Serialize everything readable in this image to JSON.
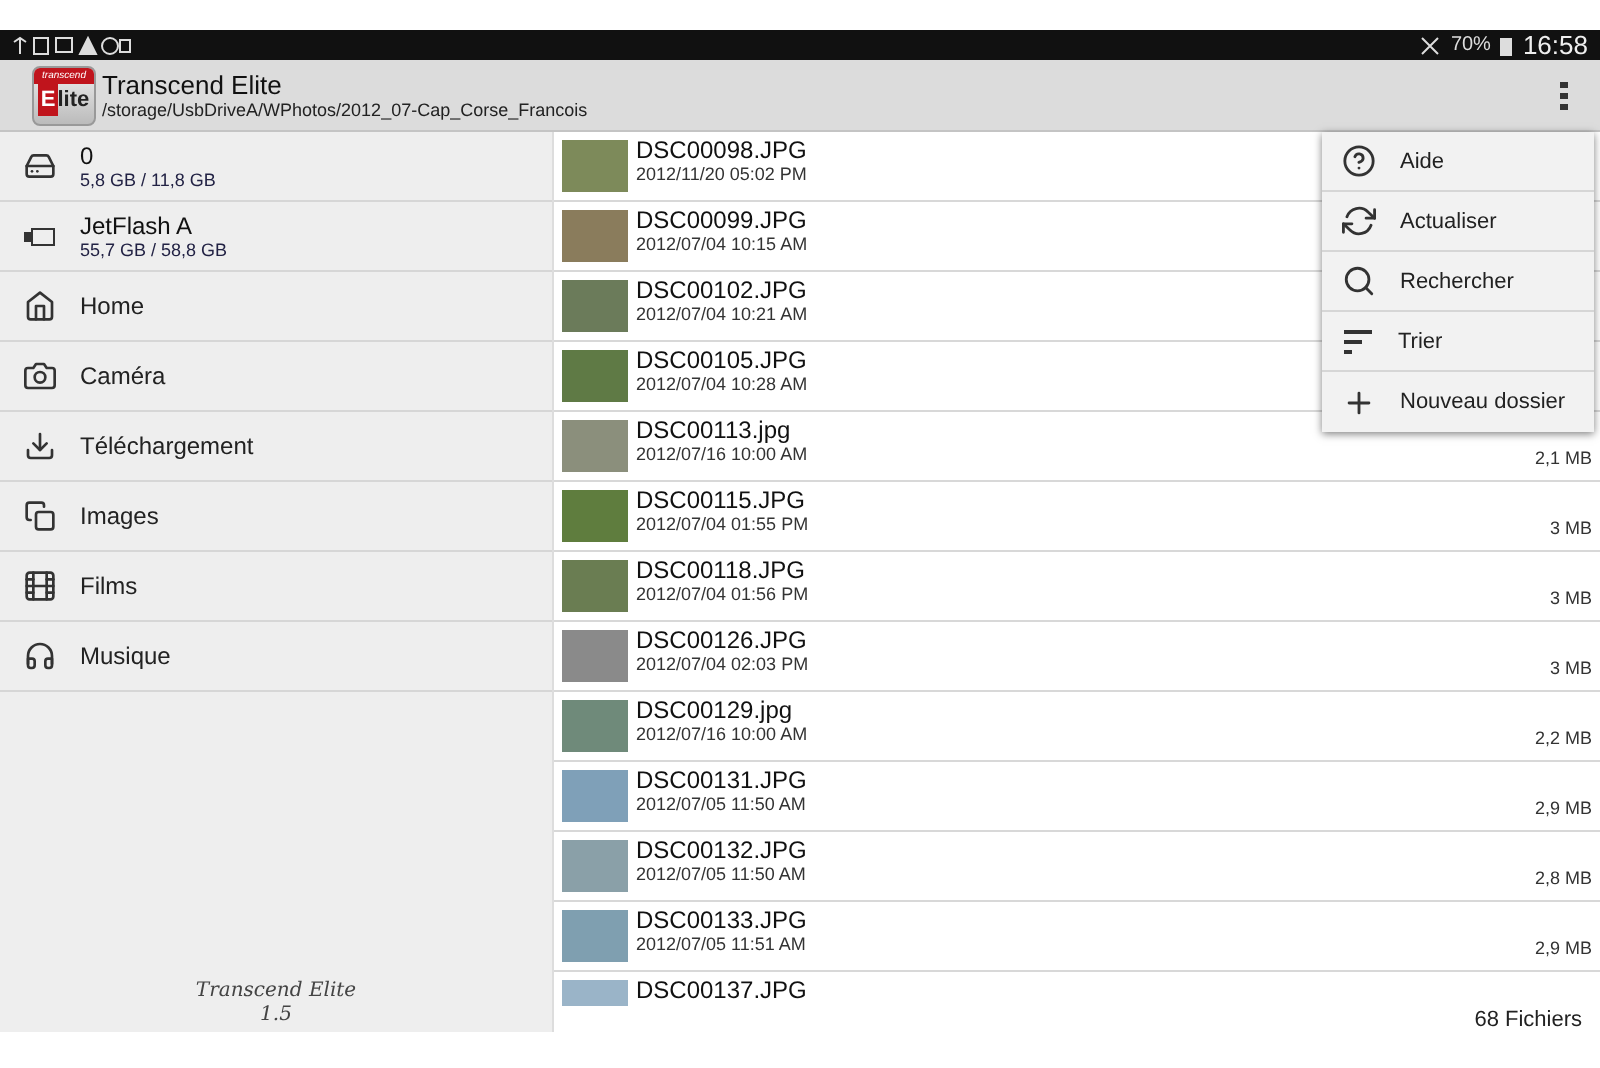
{
  "status_bar": {
    "battery": "70%",
    "time": "16:58"
  },
  "app_bar": {
    "logo": {
      "brand": "transcend",
      "initial": "E",
      "rest": "lite"
    },
    "title": "Transcend Elite",
    "path": "/storage/UsbDriveA/WPhotos/2012_07-Cap_Corse_Francois"
  },
  "storage": [
    {
      "kind": "internal",
      "name": "0",
      "capacity": "5,8 GB / 11,8 GB"
    },
    {
      "kind": "usb",
      "name": "JetFlash A",
      "capacity": "55,7 GB / 58,8 GB"
    }
  ],
  "sidebar": {
    "items": [
      {
        "kind": "home",
        "label": "Home"
      },
      {
        "kind": "camera",
        "label": "Caméra"
      },
      {
        "kind": "download",
        "label": "Téléchargement"
      },
      {
        "kind": "images",
        "label": "Images"
      },
      {
        "kind": "films",
        "label": "Films"
      },
      {
        "kind": "music",
        "label": "Musique"
      }
    ],
    "app_name": "Transcend Elite",
    "version": "1.5"
  },
  "files": [
    {
      "name": "DSC00098.JPG",
      "date": "2012/11/20 05:02 PM"
    },
    {
      "name": "DSC00099.JPG",
      "date": "2012/07/04 10:15 AM"
    },
    {
      "name": "DSC00102.JPG",
      "date": "2012/07/04 10:21 AM"
    },
    {
      "name": "DSC00105.JPG",
      "date": "2012/07/04 10:28 AM"
    },
    {
      "name": "DSC00113.jpg",
      "date": "2012/07/16 10:00 AM",
      "size": "2,1 MB"
    },
    {
      "name": "DSC00115.JPG",
      "date": "2012/07/04 01:55 PM",
      "size": "3 MB"
    },
    {
      "name": "DSC00118.JPG",
      "date": "2012/07/04 01:56 PM",
      "size": "3 MB"
    },
    {
      "name": "DSC00126.JPG",
      "date": "2012/07/04 02:03 PM",
      "size": "3 MB"
    },
    {
      "name": "DSC00129.jpg",
      "date": "2012/07/16 10:00 AM",
      "size": "2,2 MB"
    },
    {
      "name": "DSC00131.JPG",
      "date": "2012/07/05 11:50 AM",
      "size": "2,9 MB"
    },
    {
      "name": "DSC00132.JPG",
      "date": "2012/07/05 11:50 AM",
      "size": "2,8 MB"
    },
    {
      "name": "DSC00133.JPG",
      "date": "2012/07/05 11:51 AM",
      "size": "2,9 MB"
    },
    {
      "name": "DSC00137.JPG"
    }
  ],
  "file_count": "68 Fichiers",
  "menu": [
    {
      "kind": "help",
      "label": "Aide"
    },
    {
      "kind": "refresh",
      "label": "Actualiser"
    },
    {
      "kind": "search",
      "label": "Rechercher"
    },
    {
      "kind": "sort",
      "label": "Trier"
    },
    {
      "kind": "add",
      "label": "Nouveau dossier"
    }
  ]
}
